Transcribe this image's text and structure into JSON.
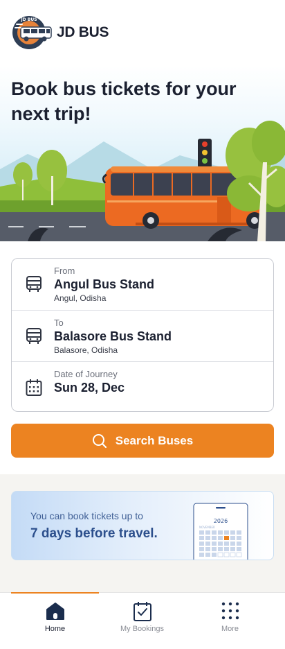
{
  "app": {
    "name": "JD BUS",
    "logo_text": "JD BUS"
  },
  "hero": {
    "title": "Book bus tickets for your next trip!"
  },
  "search": {
    "from": {
      "label": "From",
      "name": "Angul Bus Stand",
      "place": "Angul, Odisha",
      "icon": "bus-icon"
    },
    "to": {
      "label": "To",
      "name": "Balasore Bus Stand",
      "place": "Balasore, Odisha",
      "icon": "bus-icon"
    },
    "date": {
      "label": "Date of Journey",
      "value": "Sun 28, Dec",
      "icon": "calendar-icon"
    },
    "button_label": "Search Buses"
  },
  "info": {
    "line1": "You can book tickets up to",
    "line2": "7 days before travel.",
    "calendar_year": "2026",
    "calendar_month": "NOVEMBER"
  },
  "nav": {
    "items": [
      {
        "label": "Home",
        "icon": "home-icon",
        "active": true
      },
      {
        "label": "My Bookings",
        "icon": "bookings-icon",
        "active": false
      },
      {
        "label": "More",
        "icon": "grid-icon",
        "active": false
      }
    ]
  },
  "colors": {
    "accent": "#ec8321",
    "text": "#1b2030",
    "info_text": "#2c4f8c"
  }
}
